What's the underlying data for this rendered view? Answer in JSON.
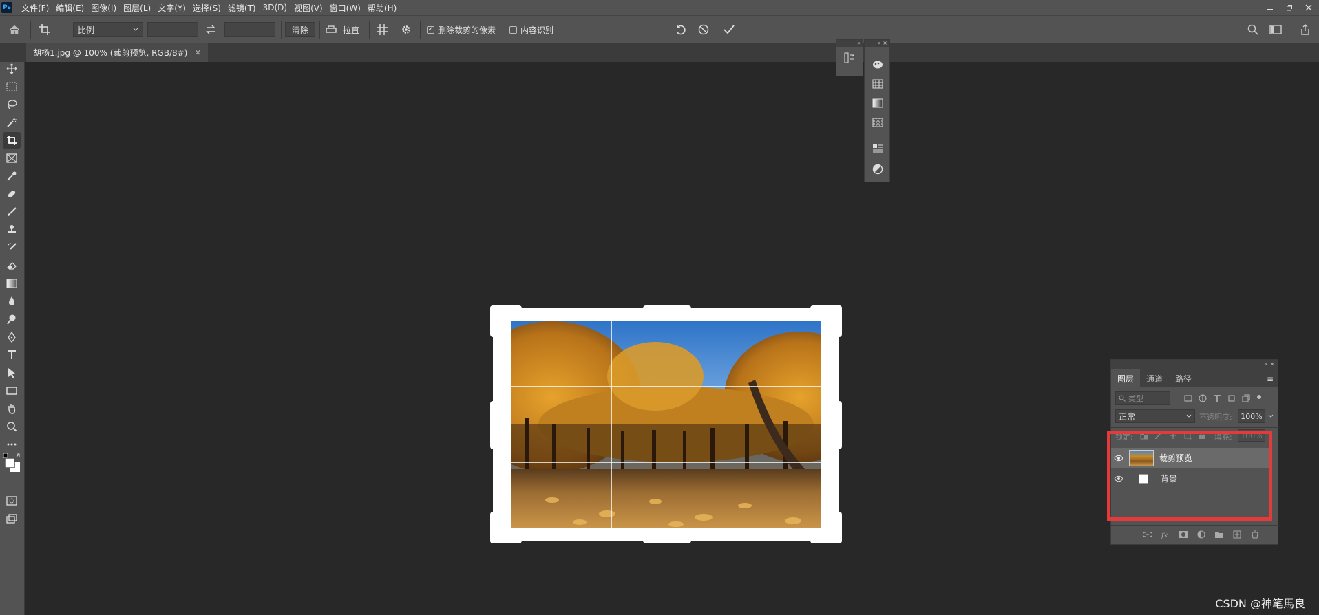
{
  "app": {
    "logo": "Ps"
  },
  "menu": [
    "文件(F)",
    "编辑(E)",
    "图像(I)",
    "图层(L)",
    "文字(Y)",
    "选择(S)",
    "滤镜(T)",
    "3D(D)",
    "视图(V)",
    "窗口(W)",
    "帮助(H)"
  ],
  "options": {
    "ratio_value": "比例",
    "clear_label": "清除",
    "straighten_label": "拉直",
    "delete_cropped_label": "删除裁剪的像素",
    "delete_cropped_checked": true,
    "content_aware_label": "内容识别",
    "content_aware_checked": false
  },
  "document": {
    "tab_title": "胡杨1.jpg @ 100% (裁剪预览, RGB/8#)",
    "close_glyph": "×"
  },
  "layers_panel": {
    "tabs": [
      "图层",
      "通道",
      "路径"
    ],
    "search_placeholder": "类型",
    "blend_mode": "正常",
    "opacity_label": "不透明度:",
    "opacity_value": "100%",
    "lock_label": "锁定:",
    "fill_label": "填充:",
    "fill_value": "100%",
    "layers": [
      {
        "name": "裁剪预览",
        "selected": true
      },
      {
        "name": "背景",
        "selected": false
      }
    ]
  },
  "annotation": {
    "highlight_color": "#e53a3a"
  },
  "watermark": "CSDN @神笔馬良",
  "icons": [
    "home-icon",
    "crop-icon",
    "swap-icon",
    "straighten-icon",
    "grid-overlay-icon",
    "gear-icon",
    "reset-icon",
    "cancel-icon",
    "commit-icon",
    "search-icon",
    "workspace-icon",
    "share-icon"
  ]
}
